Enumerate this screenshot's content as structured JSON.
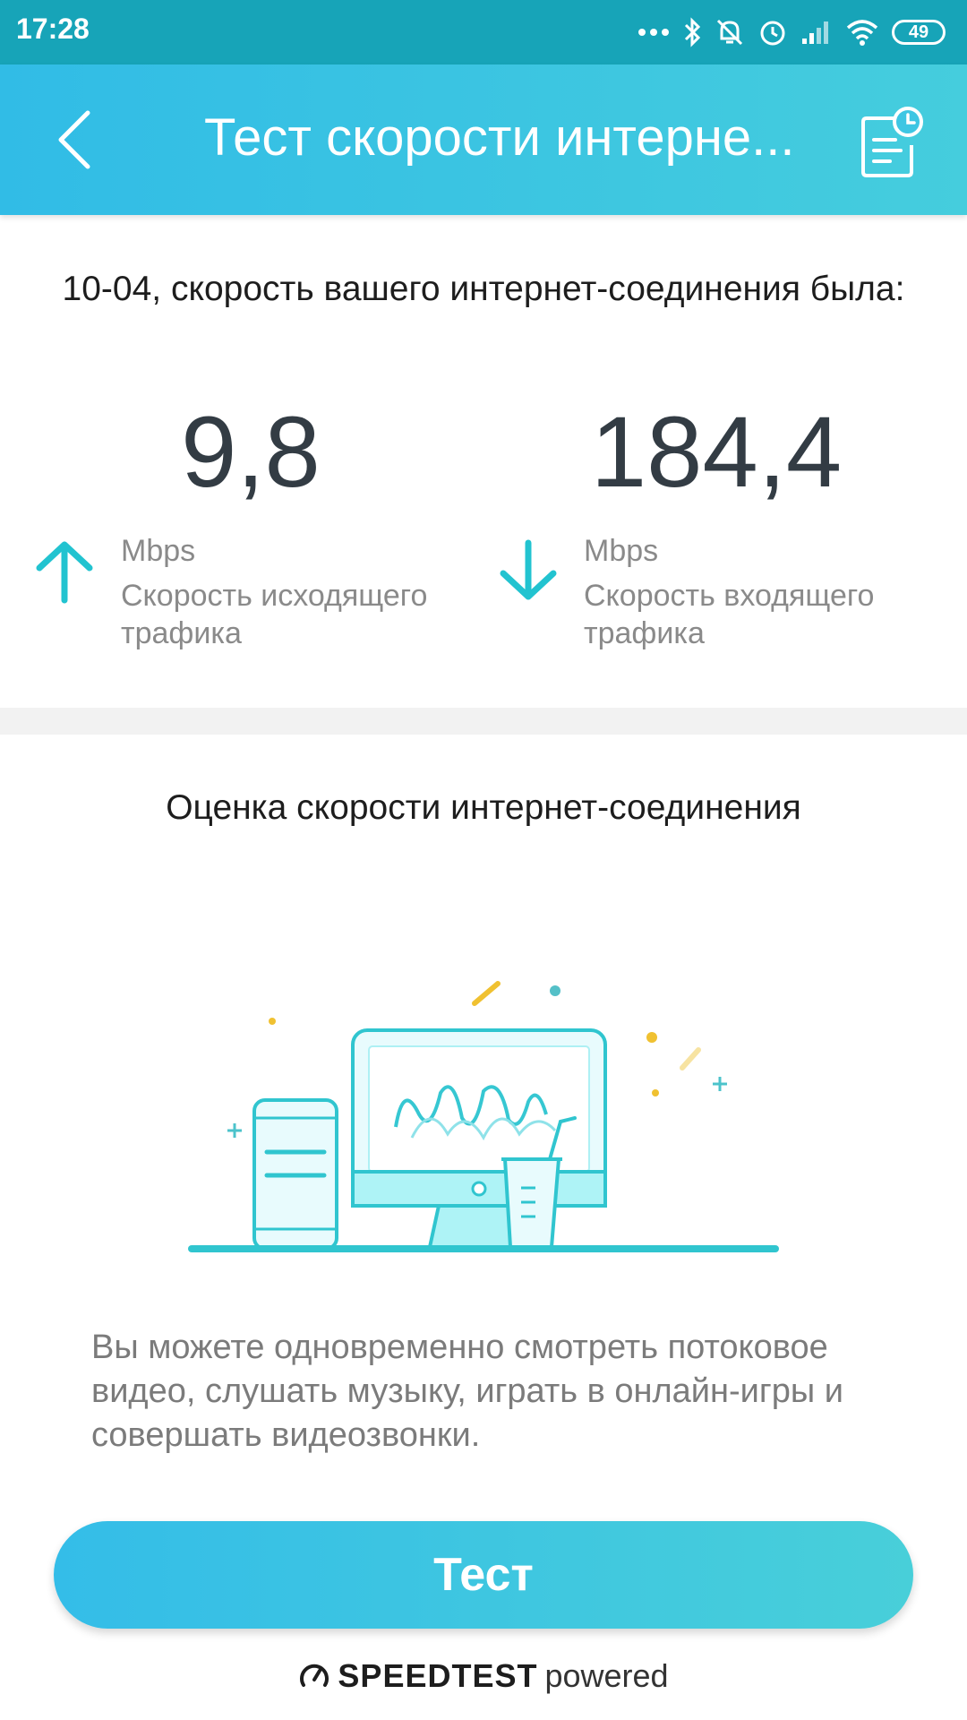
{
  "status_bar": {
    "time": "17:28",
    "battery": "49",
    "icons": [
      "more-icon",
      "bluetooth-icon",
      "silent-icon",
      "alarm-icon",
      "signal-icon",
      "wifi-icon",
      "battery-icon"
    ]
  },
  "header": {
    "title": "Тест скорости интерне...",
    "back_icon": "chevron-left-icon",
    "history_icon": "history-icon"
  },
  "result": {
    "date_line": "10-04, скорость вашего интернет-соединения была:",
    "upload": {
      "value": "9,8",
      "unit": "Mbps",
      "label": "Скорость исходящего трафика"
    },
    "download": {
      "value": "184,4",
      "unit": "Mbps",
      "label": "Скорость входящего трафика"
    }
  },
  "rating": {
    "title": "Оценка скорости интернет-соединения",
    "description": "Вы можете одновременно смотреть потоковое видео, слушать музыку, играть в онлайн-игры и совершать видеозвонки."
  },
  "action": {
    "test_label": "Тест"
  },
  "footer": {
    "brand": "SPEEDTEST",
    "powered": "powered"
  },
  "colors": {
    "accent": "#3ec3e0",
    "statusbar": "#17a4b8",
    "teal": "#22c3d0"
  }
}
